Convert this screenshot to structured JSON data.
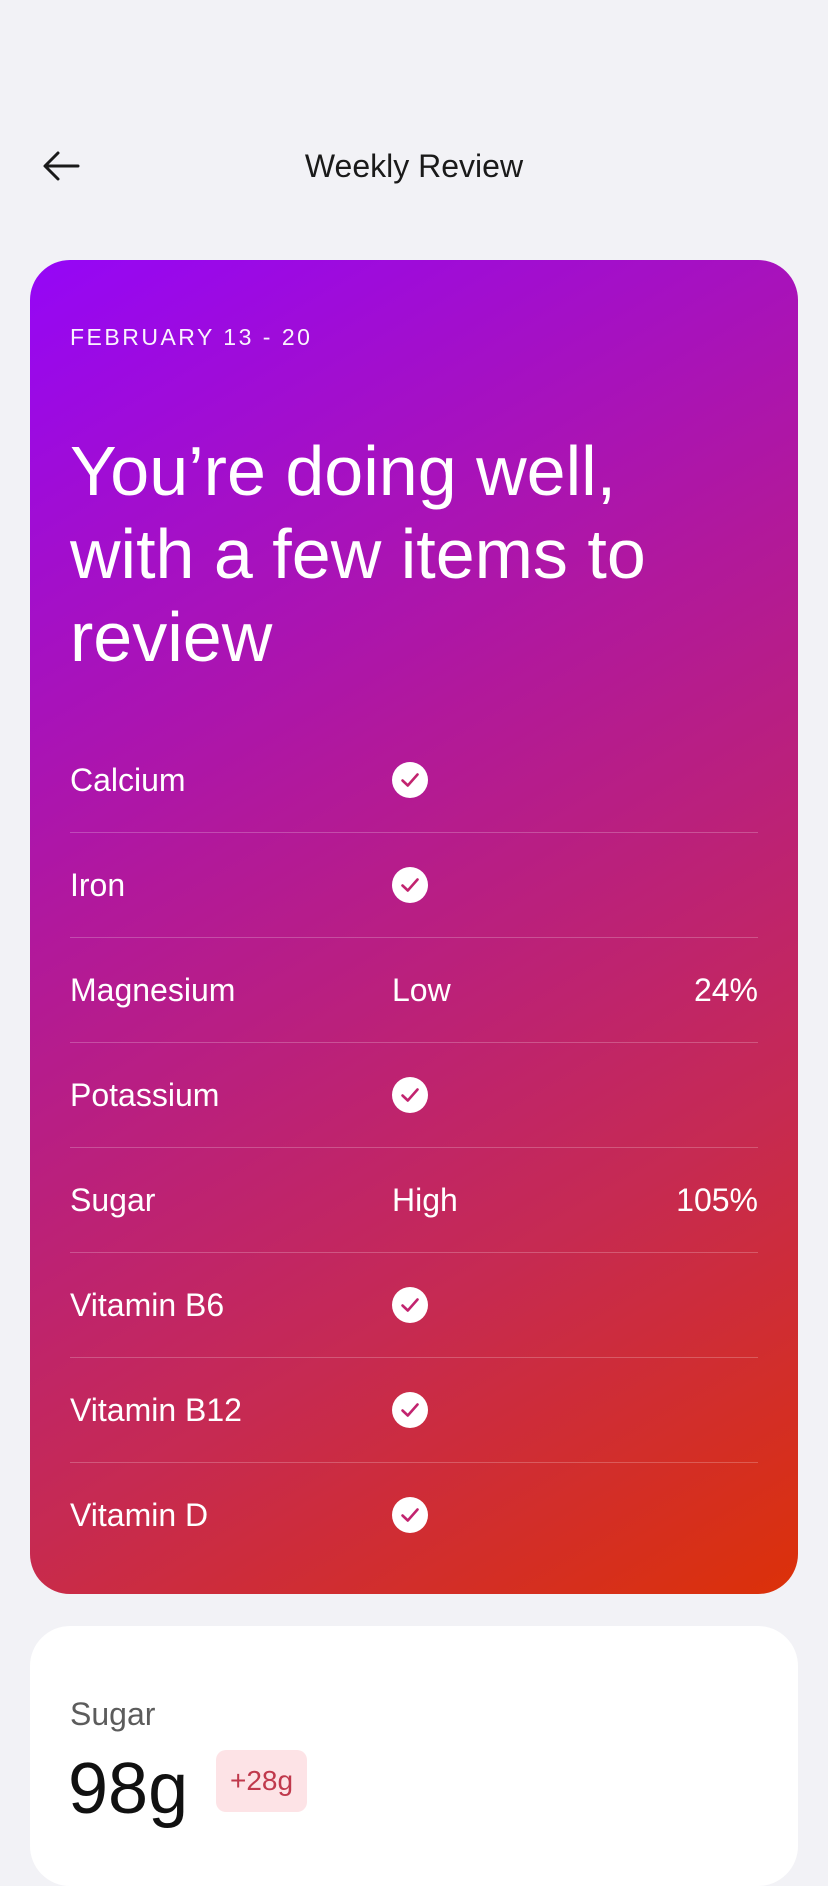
{
  "header": {
    "title": "Weekly Review",
    "back_icon": "arrow-left-icon"
  },
  "hero": {
    "date_range": "FEBRUARY 13 - 20",
    "headline": "You’re doing well, with a few items to review",
    "gradient": [
      "#9506f7",
      "#b1189d",
      "#c62a52",
      "#dc3108"
    ],
    "check_color": "#c2246f",
    "nutrients": [
      {
        "name": "Calcium",
        "ok": true,
        "status": "",
        "percent": ""
      },
      {
        "name": "Iron",
        "ok": true,
        "status": "",
        "percent": ""
      },
      {
        "name": "Magnesium",
        "ok": false,
        "status": "Low",
        "percent": "24%"
      },
      {
        "name": "Potassium",
        "ok": true,
        "status": "",
        "percent": ""
      },
      {
        "name": "Sugar",
        "ok": false,
        "status": "High",
        "percent": "105%"
      },
      {
        "name": "Vitamin B6",
        "ok": true,
        "status": "",
        "percent": ""
      },
      {
        "name": "Vitamin B12",
        "ok": true,
        "status": "",
        "percent": ""
      },
      {
        "name": "Vitamin D",
        "ok": true,
        "status": "",
        "percent": ""
      }
    ]
  },
  "sugar_card": {
    "label": "Sugar",
    "value": "98g",
    "delta": "+28g",
    "delta_color": "#c0394c",
    "delta_bg": "#fde3e6"
  }
}
